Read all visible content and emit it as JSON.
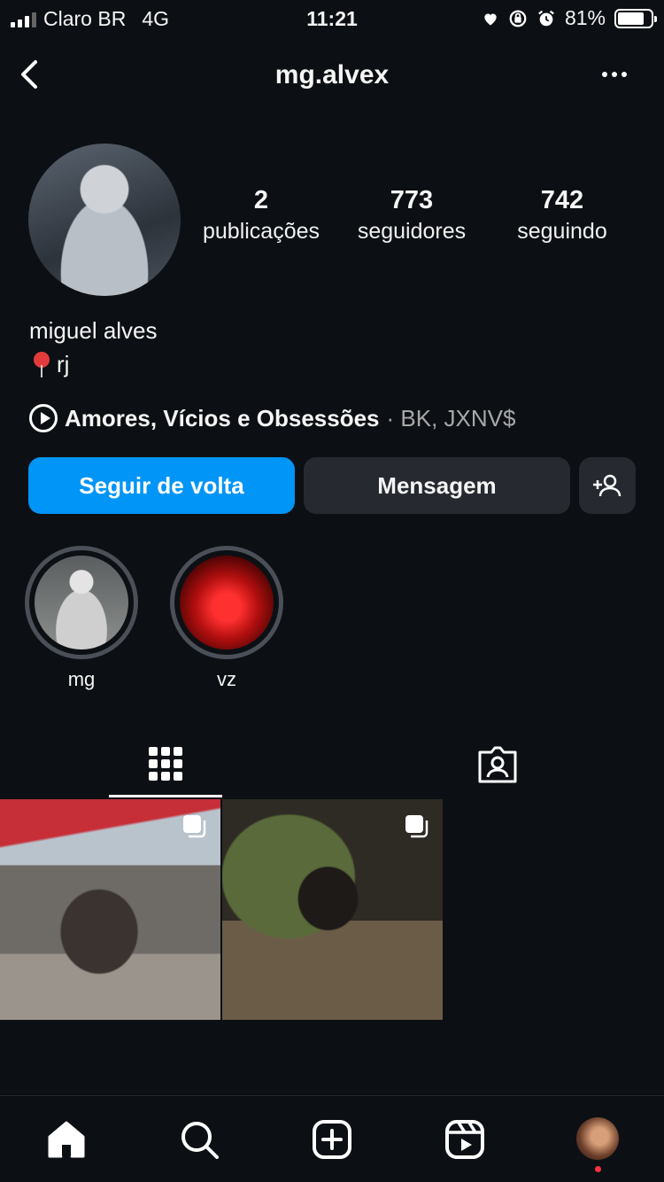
{
  "status_bar": {
    "carrier": "Claro BR",
    "network": "4G",
    "time": "11:21",
    "battery": "81%",
    "battery_level": 0.81,
    "icons": [
      "heart-icon",
      "orientation-lock-icon",
      "alarm-icon"
    ]
  },
  "header": {
    "username": "mg.alvex",
    "back_icon": "chevron-left-icon",
    "more_icon": "more-dots-icon"
  },
  "profile": {
    "stats": [
      {
        "value": "2",
        "label": "publicações"
      },
      {
        "value": "773",
        "label": "seguidores"
      },
      {
        "value": "742",
        "label": "seguindo"
      }
    ],
    "full_name": "miguel alves",
    "location_emoji": "pin-icon",
    "location": "rj",
    "music": {
      "song": "Amores, Vícios e Obsessões",
      "artist": "· BK, JXNV$"
    }
  },
  "actions": {
    "follow_back": "Seguir de volta",
    "message": "Mensagem",
    "suggest_icon": "add-person-icon"
  },
  "highlights": [
    {
      "label": "mg"
    },
    {
      "label": "vz"
    }
  ],
  "tabs": {
    "active": "grid",
    "items": [
      "grid-icon",
      "tagged-icon"
    ]
  },
  "posts": [
    {
      "type": "carousel"
    },
    {
      "type": "carousel"
    }
  ],
  "bottom_nav": [
    "home-icon",
    "search-icon",
    "create-icon",
    "reels-icon",
    "profile-avatar"
  ],
  "colors": {
    "background": "#0c1014",
    "primary_button": "#0095f6",
    "secondary_button": "#262a30",
    "notification_dot": "#ff3040"
  }
}
